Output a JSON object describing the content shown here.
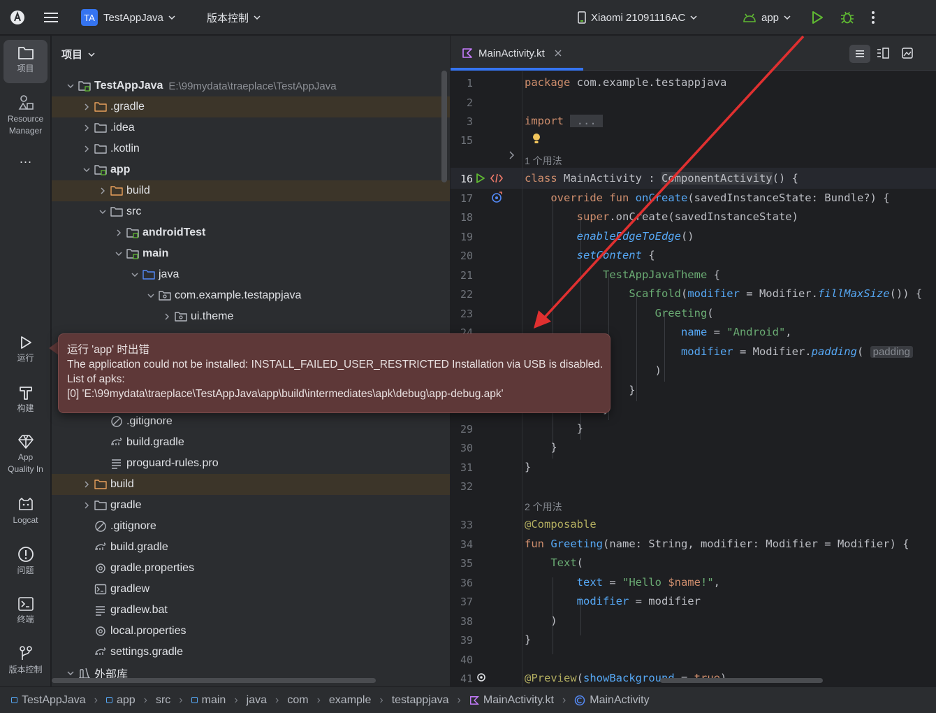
{
  "toolbar": {
    "project_badge": "TA",
    "project_name": "TestAppJava",
    "vcs_label": "版本控制",
    "device_name": "Xiaomi 21091116AC",
    "run_config": "app"
  },
  "left_toolbar": {
    "project": "项目",
    "resource_manager_1": "Resource",
    "resource_manager_2": "Manager",
    "more": "···",
    "run": "运行",
    "build": "构建",
    "app_quality_1": "App",
    "app_quality_2": "Quality In",
    "logcat": "Logcat",
    "problems": "问题",
    "terminal": "终端",
    "vcs": "版本控制"
  },
  "project_panel": {
    "header": "项目",
    "rows": [
      {
        "label": "TestAppJava",
        "path": "E:\\99mydata\\traeplace\\TestAppJava",
        "bold": true,
        "indent": 0,
        "arrow": "down",
        "icon": "module-folder"
      },
      {
        "label": ".gradle",
        "indent": 1,
        "arrow": "right",
        "icon": "folder-excluded",
        "hl": true
      },
      {
        "label": ".idea",
        "indent": 1,
        "arrow": "right",
        "icon": "folder"
      },
      {
        "label": ".kotlin",
        "indent": 1,
        "arrow": "right",
        "icon": "folder"
      },
      {
        "label": "app",
        "bold": true,
        "indent": 1,
        "arrow": "down",
        "icon": "module-folder"
      },
      {
        "label": "build",
        "indent": 2,
        "arrow": "right",
        "icon": "folder-excluded",
        "hl": true
      },
      {
        "label": "src",
        "indent": 2,
        "arrow": "down",
        "icon": "folder"
      },
      {
        "label": "androidTest",
        "bold": true,
        "indent": 3,
        "arrow": "right",
        "icon": "module-folder"
      },
      {
        "label": "main",
        "bold": true,
        "indent": 3,
        "arrow": "down",
        "icon": "module-folder"
      },
      {
        "label": "java",
        "indent": 4,
        "arrow": "down",
        "icon": "source-folder"
      },
      {
        "label": "com.example.testappjava",
        "indent": 5,
        "arrow": "down",
        "icon": "package"
      },
      {
        "label": "ui.theme",
        "indent": 6,
        "arrow": "right",
        "icon": "package"
      },
      {
        "label": ".gitignore",
        "indent": 2,
        "arrow": "",
        "icon": "ignore-file",
        "slot": 16
      },
      {
        "label": "build.gradle",
        "indent": 2,
        "arrow": "",
        "icon": "gradle-file",
        "slot": 17
      },
      {
        "label": "proguard-rules.pro",
        "indent": 2,
        "arrow": "",
        "icon": "text-file",
        "slot": 18
      },
      {
        "label": "build",
        "indent": 1,
        "arrow": "right",
        "icon": "folder-excluded",
        "hl": true,
        "slot": 19
      },
      {
        "label": "gradle",
        "indent": 1,
        "arrow": "right",
        "icon": "folder",
        "slot": 20
      },
      {
        "label": ".gitignore",
        "indent": 1,
        "arrow": "",
        "icon": "ignore-file",
        "slot": 21
      },
      {
        "label": "build.gradle",
        "indent": 1,
        "arrow": "",
        "icon": "gradle-file",
        "slot": 22
      },
      {
        "label": "gradle.properties",
        "indent": 1,
        "arrow": "",
        "icon": "settings-file",
        "slot": 23
      },
      {
        "label": "gradlew",
        "indent": 1,
        "arrow": "",
        "icon": "terminal-file",
        "slot": 24
      },
      {
        "label": "gradlew.bat",
        "indent": 1,
        "arrow": "",
        "icon": "text-file",
        "slot": 25
      },
      {
        "label": "local.properties",
        "indent": 1,
        "arrow": "",
        "icon": "settings-file",
        "slot": 26
      },
      {
        "label": "settings.gradle",
        "indent": 1,
        "arrow": "",
        "icon": "gradle-file",
        "slot": 27
      },
      {
        "label": "外部库",
        "indent": 0,
        "arrow": "down",
        "icon": "library",
        "slot": 28
      }
    ]
  },
  "editor": {
    "tab_label": "MainActivity.kt",
    "usages_1": "1 个用法",
    "usages_2": "2 个用法",
    "line_numbers": [
      "1",
      "2",
      "3",
      "15",
      "16",
      "17",
      "18",
      "19",
      "20",
      "21",
      "22",
      "23",
      "24",
      "29",
      "30",
      "31",
      "32",
      "33",
      "34",
      "35",
      "36",
      "37",
      "38",
      "39",
      "40",
      "41"
    ],
    "inlay_hint": "padding"
  },
  "error_popup": {
    "title": "运行 'app' 时出错",
    "message": "The application could not be installed: INSTALL_FAILED_USER_RESTRICTED Installation via USB is disabled.",
    "list_label": "List of apks:",
    "apk_path": "[0] 'E:\\99mydata\\traeplace\\TestAppJava\\app\\build\\intermediates\\apk\\debug\\app-debug.apk'"
  },
  "breadcrumbs": [
    "TestAppJava",
    "app",
    "src",
    "main",
    "java",
    "com",
    "example",
    "testappjava",
    "MainActivity.kt",
    "MainActivity"
  ],
  "colors": {
    "accent": "#3574f0",
    "error_bg": "#5e3838",
    "arrow": "#e03030",
    "run_green": "#5fb832"
  }
}
